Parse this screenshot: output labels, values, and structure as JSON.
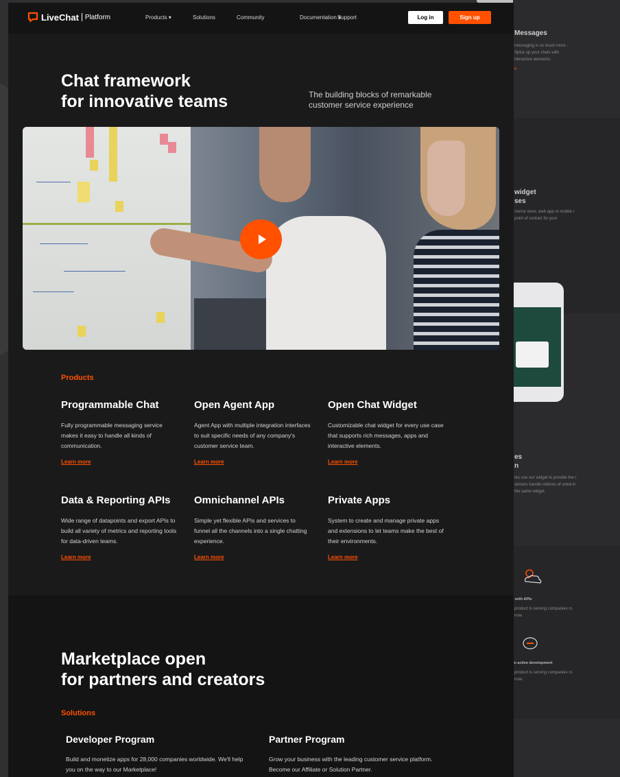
{
  "nav": {
    "brand": "LiveChat",
    "brand_sub": "Platform",
    "items": [
      {
        "label": "Products",
        "dropdown": true
      },
      {
        "label": "Solutions",
        "dropdown": false
      },
      {
        "label": "Community",
        "dropdown": false
      },
      {
        "label": "Documentation",
        "dropdown": true
      },
      {
        "label": "Support",
        "dropdown": false
      }
    ],
    "login_label": "Log in",
    "signup_label": "Sign up"
  },
  "hero": {
    "title_line1": "Chat framework",
    "title_line2": "for innovative teams",
    "subtitle": "The building blocks of remarkable customer service experience"
  },
  "video": {
    "play_icon": "play-icon"
  },
  "products": {
    "section_label": "Products",
    "items": [
      {
        "title": "Programmable Chat",
        "desc": "Fully programmable messaging service makes it easy to handle all kinds of communication.",
        "link": "Learn more"
      },
      {
        "title": "Open Agent App",
        "desc": "Agent App with multiple integration interfaces to suit specific needs of any company's customer service team.",
        "link": "Learn more"
      },
      {
        "title": "Open Chat Widget",
        "desc": "Customizable chat widget for every use case that supports rich messages, apps and interactive elements.",
        "link": "Learn more"
      },
      {
        "title": "Data & Reporting APIs",
        "desc": "Wide range of datapoints and export APIs to build all variety of metrics and reporting tools for data-driven teams.",
        "link": "Learn more"
      },
      {
        "title": "Omnichannel APIs",
        "desc": "Simple yet flexible APIs and services to funnel all the channels into a single chatting experience.",
        "link": "Learn more"
      },
      {
        "title": "Private Apps",
        "desc": "System to create and manage private apps and extensions to let teams make the best of their environments.",
        "link": "Learn more"
      }
    ]
  },
  "marketplace": {
    "title_line1": "Marketplace open",
    "title_line2": "for partners and creators",
    "section_label": "Solutions",
    "items": [
      {
        "title": "Developer Program",
        "desc": "Build and monetize apps for 28,000 companies worldwide. We'll help you on the way to our Marketplace!"
      },
      {
        "title": "Partner Program",
        "desc": "Grow your business with the leading customer service platform. Become our Affiliate or Solution Partner."
      }
    ]
  },
  "background": {
    "h1": "Messages",
    "t1": "messaging is so much more . Spice up your chats with nteractive elements.",
    "h2": "widget\nses",
    "t2": "merce store, web app or mobile l point of contact for your",
    "h3": "es\nn",
    "t3": "tes use our widget to provide the r servers handle millions of orted in the same widget.",
    "s1": "l with APIs",
    "t4": "product is serving companies rs now.",
    "s2": "in active development",
    "t5": "product is serving companies rs now."
  },
  "colors": {
    "accent": "#ff5100",
    "page_bg": "#1a1a1b",
    "nav_bg": "#141415"
  }
}
